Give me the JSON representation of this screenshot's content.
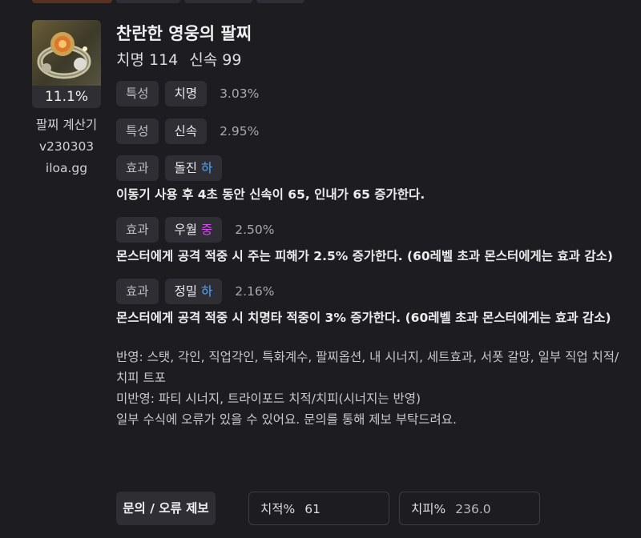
{
  "item": {
    "name": "찬란한 영웅의 팔찌",
    "stats": "치명 114",
    "stats2": "신속 99",
    "percent": "11.1%",
    "icon": "bracelet-icon"
  },
  "app": {
    "name": "팔찌 계산기",
    "version": "v230303",
    "site": "iloa.gg"
  },
  "rows": [
    {
      "tag": "특성",
      "name": "치명",
      "level": "",
      "value": "3.03%",
      "desc": ""
    },
    {
      "tag": "특성",
      "name": "신속",
      "level": "",
      "value": "2.95%",
      "desc": ""
    },
    {
      "tag": "효과",
      "name": "돌진",
      "level": "하",
      "value": "",
      "desc": "이동기 사용 후 4초 동안 신속이 65, 인내가 65 증가한다."
    },
    {
      "tag": "효과",
      "name": "우월",
      "level": "중",
      "value": "2.50%",
      "desc": "몬스터에게 공격 적중 시 주는 피해가 2.5% 증가한다. (60레벨 초과 몬스터에게는 효과 감소)"
    },
    {
      "tag": "효과",
      "name": "정밀",
      "level": "하",
      "value": "2.16%",
      "desc": "몬스터에게 공격 적중 시 치명타 적중이 3% 증가한다. (60레벨 초과 몬스터에게는 효과 감소)"
    }
  ],
  "footer": {
    "applied": "반영: 스탯, 각인, 직업각인, 특화계수, 팔찌옵션, 내 시너지, 세트효과, 서폿 갈망, 일부 직업 치적/치피 트포",
    "not_applied": "미반영: 파티 시너지, 트라이포드 치적/치피(시너지는 반영)",
    "notice": "일부 수식에 오류가 있을 수 있어요. 문의를 통해 제보 부탁드려요."
  },
  "controls": {
    "report_label": "문의 / 오류 제보",
    "crit_rate_label": "치적%",
    "crit_rate_value": "61",
    "crit_dmg_label": "치피%",
    "crit_dmg_value": "236.0"
  },
  "colors": {
    "level_low": "#4fa8ff",
    "level_mid": "#d44bf0",
    "background": "#1d1d21",
    "chip": "#2e2e34"
  }
}
